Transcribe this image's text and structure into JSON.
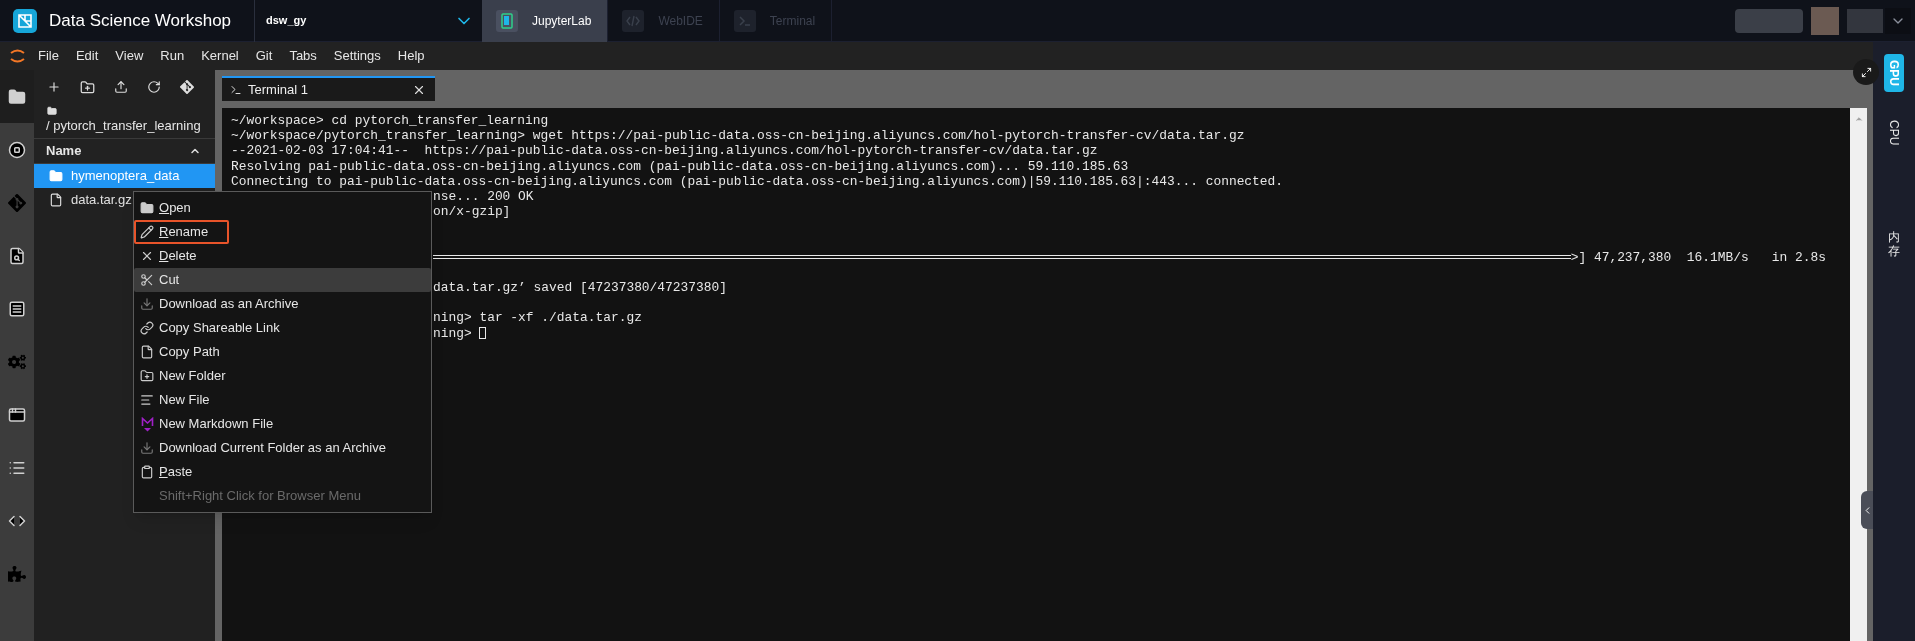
{
  "header": {
    "title": "Data Science Workshop",
    "instance": "dsw_gy",
    "tabs": [
      {
        "label": "JupyterLab",
        "selected": true
      },
      {
        "label": "WebIDE",
        "selected": false
      },
      {
        "label": "Terminal",
        "selected": false
      }
    ]
  },
  "menu_bar": [
    "File",
    "Edit",
    "View",
    "Run",
    "Kernel",
    "Git",
    "Tabs",
    "Settings",
    "Help"
  ],
  "activity_bar": [
    {
      "selected": true
    },
    {
      "selected": false
    },
    {
      "selected": false
    },
    {
      "selected": false
    },
    {
      "selected": false
    },
    {
      "selected": false
    },
    {
      "selected": false
    },
    {
      "selected": false
    },
    {
      "selected": false
    },
    {
      "selected": false
    }
  ],
  "file_browser": {
    "breadcrumb": "/ pytorch_transfer_learning",
    "column": "Name",
    "files": [
      {
        "name": "hymenoptera_data",
        "kind": "folder",
        "selected": true
      },
      {
        "name": "data.tar.gz",
        "kind": "file",
        "selected": false
      }
    ]
  },
  "document_tabs": [
    {
      "label": "Terminal 1",
      "selected": true
    }
  ],
  "terminal": {
    "lines": [
      {
        "kind": "full",
        "text": "~/workspace> cd pytorch_transfer_learning"
      },
      {
        "kind": "full",
        "text": "~/workspace/pytorch_transfer_learning> wget https://pai-public-data.oss-cn-beijing.aliyuncs.com/hol-pytorch-transfer-cv/data.tar.gz"
      },
      {
        "kind": "full",
        "text": "--2021-02-03 17:04:41--  https://pai-public-data.oss-cn-beijing.aliyuncs.com/hol-pytorch-transfer-cv/data.tar.gz"
      },
      {
        "kind": "full",
        "text": "Resolving pai-public-data.oss-cn-beijing.aliyuncs.com (pai-public-data.oss-cn-beijing.aliyuncs.com)... 59.110.185.63"
      },
      {
        "kind": "full",
        "text": "Connecting to pai-public-data.oss-cn-beijing.aliyuncs.com (pai-public-data.oss-cn-beijing.aliyuncs.com)|59.110.185.63|:443... connected."
      },
      {
        "kind": "cut",
        "text": "nse... 200 OK"
      },
      {
        "kind": "cut",
        "text": "on/x-gzip]"
      },
      {
        "kind": "blank"
      },
      {
        "kind": "blank"
      },
      {
        "kind": "progress",
        "text": ">] 47,237,380  16.1MB/s   in 2.8s"
      },
      {
        "kind": "blank"
      },
      {
        "kind": "cut",
        "text": "data.tar.gz’ saved [47237380/47237380]"
      },
      {
        "kind": "blank"
      },
      {
        "kind": "cut",
        "text": "ning> tar -xf ./data.tar.gz"
      },
      {
        "kind": "cursor",
        "text": "ning>"
      }
    ]
  },
  "context_menu": {
    "items": [
      {
        "label": "Open",
        "underline_first": true,
        "hovered": false,
        "highlighted": false,
        "disabled": false
      },
      {
        "label": "Rename",
        "underline_first": true,
        "hovered": false,
        "highlighted": true,
        "disabled": false
      },
      {
        "label": "Delete",
        "underline_first": true,
        "hovered": false,
        "highlighted": false,
        "disabled": false
      },
      {
        "label": "Cut",
        "underline_first": false,
        "hovered": true,
        "highlighted": false,
        "disabled": false
      },
      {
        "label": "Download as an Archive",
        "underline_first": false,
        "hovered": false,
        "highlighted": false,
        "disabled": false
      },
      {
        "label": "Copy Shareable Link",
        "underline_first": false,
        "hovered": false,
        "highlighted": false,
        "disabled": false
      },
      {
        "label": "Copy Path",
        "underline_first": false,
        "hovered": false,
        "highlighted": false,
        "disabled": false
      },
      {
        "label": "New Folder",
        "underline_first": false,
        "hovered": false,
        "highlighted": false,
        "disabled": false
      },
      {
        "label": "New File",
        "underline_first": false,
        "hovered": false,
        "highlighted": false,
        "disabled": false
      },
      {
        "label": "New Markdown File",
        "underline_first": false,
        "hovered": false,
        "highlighted": false,
        "disabled": false
      },
      {
        "label": "Download Current Folder as an Archive",
        "underline_first": false,
        "hovered": false,
        "highlighted": false,
        "disabled": false
      },
      {
        "label": "Paste",
        "underline_first": true,
        "hovered": false,
        "highlighted": false,
        "disabled": false
      },
      {
        "label": "Shift+Right Click for Browser Menu",
        "underline_first": false,
        "hovered": false,
        "highlighted": false,
        "disabled": true
      }
    ]
  },
  "side_panel": {
    "tabs": [
      {
        "label": "GPU",
        "kind": "latin",
        "selected": true
      },
      {
        "label": "CPU",
        "kind": "latin",
        "selected": false
      },
      {
        "label": "内存",
        "kind": "cjk",
        "selected": false
      }
    ]
  }
}
